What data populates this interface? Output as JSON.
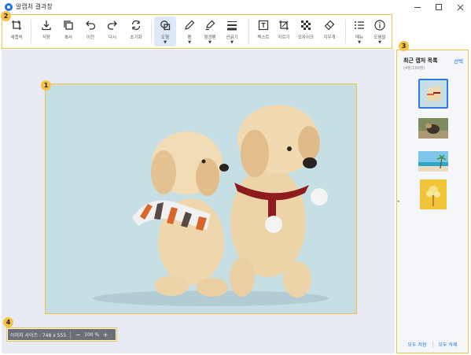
{
  "window": {
    "title": "알캡처 결과창"
  },
  "toolbar": {
    "items": [
      {
        "label": "새캡처",
        "icon": "new-capture-icon"
      },
      {
        "label": "저장",
        "icon": "download-icon"
      },
      {
        "label": "복사",
        "icon": "copy-icon"
      },
      {
        "label": "이전",
        "icon": "undo-icon"
      },
      {
        "label": "다시",
        "icon": "redo-icon"
      },
      {
        "label": "초기화",
        "icon": "refresh-icon"
      },
      {
        "label": "도형",
        "icon": "shape-icon",
        "active": true
      },
      {
        "label": "펜",
        "icon": "pen-icon"
      },
      {
        "label": "형광펜",
        "icon": "highlighter-icon"
      },
      {
        "label": "선굵기",
        "icon": "line-width-icon"
      },
      {
        "label": "텍스트",
        "icon": "text-icon"
      },
      {
        "label": "자르기",
        "icon": "crop-icon"
      },
      {
        "label": "모자이크",
        "icon": "mosaic-icon"
      },
      {
        "label": "지우개",
        "icon": "eraser-icon"
      },
      {
        "label": "메뉴",
        "icon": "menu-icon"
      },
      {
        "label": "도움말",
        "icon": "info-icon"
      }
    ]
  },
  "badges": [
    "1",
    "2",
    "3",
    "4"
  ],
  "status": {
    "image_size_label": "이미지 사이즈 : 748 x 555",
    "zoom_minus": "−",
    "zoom_value": "100 %",
    "zoom_plus": "+"
  },
  "sidebar": {
    "title": "최근 캡처 목록",
    "select_label": "선택",
    "count": "(4장/100장)",
    "thumbnails": [
      "puppies",
      "dog-outdoor",
      "beach",
      "yellow-flowers"
    ],
    "save_all": "모두 저장",
    "delete_all": "모두 삭제"
  },
  "colors": {
    "highlight": "#f5c242",
    "accent": "#1a73e8",
    "canvas_bg": "#e8ebf3",
    "photo_bg": "#c4dde4"
  }
}
